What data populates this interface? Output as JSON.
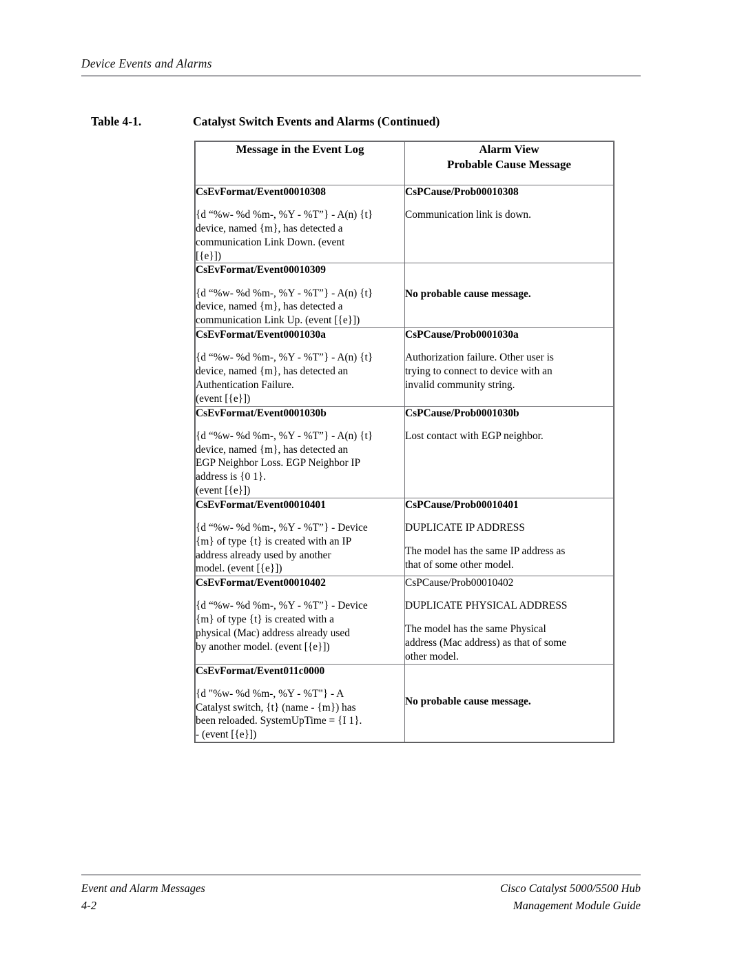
{
  "running_head": {
    "text": "Device Events and Alarms"
  },
  "table_caption": {
    "label": "Table 4-1.",
    "title": "Catalyst Switch Events and Alarms (Continued)"
  },
  "table": {
    "headers": {
      "left": "Message in the Event Log",
      "right_line1": "Alarm View",
      "right_line2": "Probable Cause Message"
    },
    "rows": [
      {
        "left_title": "CsEvFormat/Event00010308",
        "left_body": "{d “%w- %d %m-, %Y - %T”} - A(n) {t}\ndevice, named {m}, has detected a\ncommunication Link Down. (event\n[{e}])",
        "right_title": "CsPCause/Prob00010308",
        "right_title_bold": true,
        "right_body": "Communication link is down.",
        "right_body_bold": false,
        "right_body2": ""
      },
      {
        "left_title": "CsEvFormat/Event00010309",
        "left_body": "{d “%w- %d %m-, %Y - %T”} - A(n) {t}\ndevice, named {m}, has detected a\ncommunication Link Up. (event [{e}])",
        "right_title": "",
        "right_title_bold": true,
        "right_body": "No probable cause message.",
        "right_body_bold": true,
        "right_body2": ""
      },
      {
        "left_title": "CsEvFormat/Event0001030a",
        "left_body": "{d “%w- %d %m-, %Y - %T”} - A(n) {t}\ndevice, named {m}, has detected an\nAuthentication Failure.\n(event [{e}])",
        "right_title": "CsPCause/Prob0001030a",
        "right_title_bold": true,
        "right_body": "Authorization failure. Other user is\ntrying to connect to device with an\ninvalid community string.",
        "right_body_bold": false,
        "right_body2": ""
      },
      {
        "left_title": "CsEvFormat/Event0001030b",
        "left_body": "{d “%w- %d %m-, %Y - %T”} - A(n) {t}\ndevice, named {m}, has detected an\nEGP Neighbor Loss. EGP Neighbor IP\naddress is {0 1}.\n(event [{e}])",
        "right_title": "CsPCause/Prob0001030b",
        "right_title_bold": true,
        "right_body": "Lost contact with EGP neighbor.",
        "right_body_bold": false,
        "right_body2": ""
      },
      {
        "left_title": "CsEvFormat/Event00010401",
        "left_body": "{d “%w- %d %m-, %Y - %T”} - Device\n{m} of type {t} is created with an IP\naddress already used by another\nmodel. (event [{e}])",
        "right_title": "CsPCause/Prob00010401",
        "right_title_bold": true,
        "right_body": "DUPLICATE IP ADDRESS",
        "right_body_bold": false,
        "right_body2": "The model has the same IP address as\nthat of some other model."
      },
      {
        "left_title": "CsEvFormat/Event00010402",
        "left_body": "{d “%w- %d %m-, %Y - %T”} - Device\n{m} of type {t} is created with a\nphysical (Mac) address already used\nby another model. (event [{e}])",
        "right_title": "CsPCause/Prob00010402",
        "right_title_bold": false,
        "right_body": "DUPLICATE PHYSICAL ADDRESS",
        "right_body_bold": false,
        "right_body2": "The model has the same Physical\naddress (Mac address) as that of some\nother model."
      },
      {
        "left_title": "CsEvFormat/Event011c0000",
        "left_body": "{d \"%w- %d %m-, %Y - %T\"} - A\nCatalyst switch, {t} (name - {m}) has\nbeen reloaded. SystemUpTime = {I 1}.\n- (event [{e}])",
        "right_title": "",
        "right_title_bold": true,
        "right_body": "No probable cause message.",
        "right_body_bold": true,
        "right_body2": ""
      }
    ]
  },
  "footer": {
    "left_line1": "Event and Alarm Messages",
    "left_line2": "4-2",
    "right_line1": "Cisco Catalyst 5000/5500 Hub",
    "right_line2": "Management Module Guide"
  }
}
